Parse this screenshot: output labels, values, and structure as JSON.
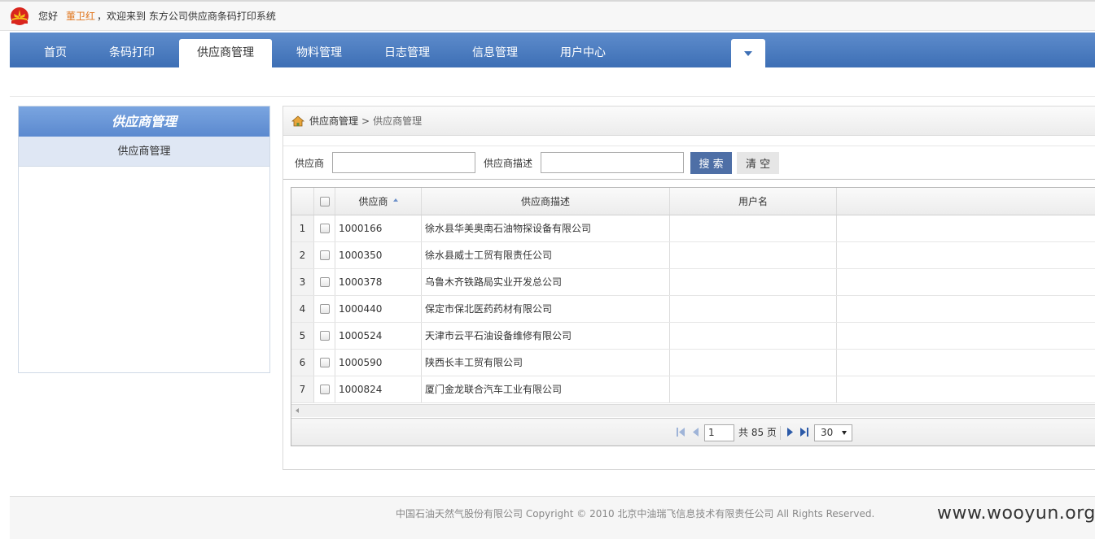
{
  "topbar": {
    "greeting": "您好",
    "username": "董卫红",
    "welcome": "，欢迎来到 东方公司供应商条码打印系统"
  },
  "nav": {
    "items": [
      {
        "label": "首页"
      },
      {
        "label": "条码打印"
      },
      {
        "label": "供应商管理",
        "active": true
      },
      {
        "label": "物料管理"
      },
      {
        "label": "日志管理"
      },
      {
        "label": "信息管理"
      },
      {
        "label": "用户中心"
      }
    ]
  },
  "sidebar": {
    "title": "供应商管理",
    "items": [
      {
        "label": "供应商管理"
      }
    ]
  },
  "breadcrumb": {
    "root": "供应商管理",
    "separator": ">",
    "current": "供应商管理"
  },
  "search": {
    "supplier_label": "供应商",
    "supplier_value": "",
    "desc_label": "供应商描述",
    "desc_value": "",
    "search_button": "搜 索",
    "clear_button": "清 空"
  },
  "grid": {
    "columns": {
      "code": "供应商",
      "desc": "供应商描述",
      "user": "用户名"
    },
    "rows": [
      {
        "num": "1",
        "code": "1000166",
        "desc": "徐水县华美奥南石油物探设备有限公司",
        "user": ""
      },
      {
        "num": "2",
        "code": "1000350",
        "desc": "徐水县威士工贸有限责任公司",
        "user": ""
      },
      {
        "num": "3",
        "code": "1000378",
        "desc": "乌鲁木齐铁路局实业开发总公司",
        "user": ""
      },
      {
        "num": "4",
        "code": "1000440",
        "desc": "保定市保北医药药材有限公司",
        "user": ""
      },
      {
        "num": "5",
        "code": "1000524",
        "desc": "天津市云平石油设备维修有限公司",
        "user": ""
      },
      {
        "num": "6",
        "code": "1000590",
        "desc": "陕西长丰工贸有限公司",
        "user": ""
      },
      {
        "num": "7",
        "code": "1000824",
        "desc": "厦门金龙联合汽车工业有限公司",
        "user": ""
      }
    ]
  },
  "pager": {
    "page": "1",
    "total_text": "共 85 页",
    "page_size": "30"
  },
  "footer": {
    "copyright": "中国石油天然气股份有限公司 Copyright © 2010 北京中油瑞飞信息技术有限责任公司 All Rights Reserved.",
    "watermark": "www.wooyun.org"
  },
  "colors": {
    "nav_blue": "#3d6fb5",
    "username_orange": "#e0751b",
    "search_button": "#4e6fa6"
  }
}
